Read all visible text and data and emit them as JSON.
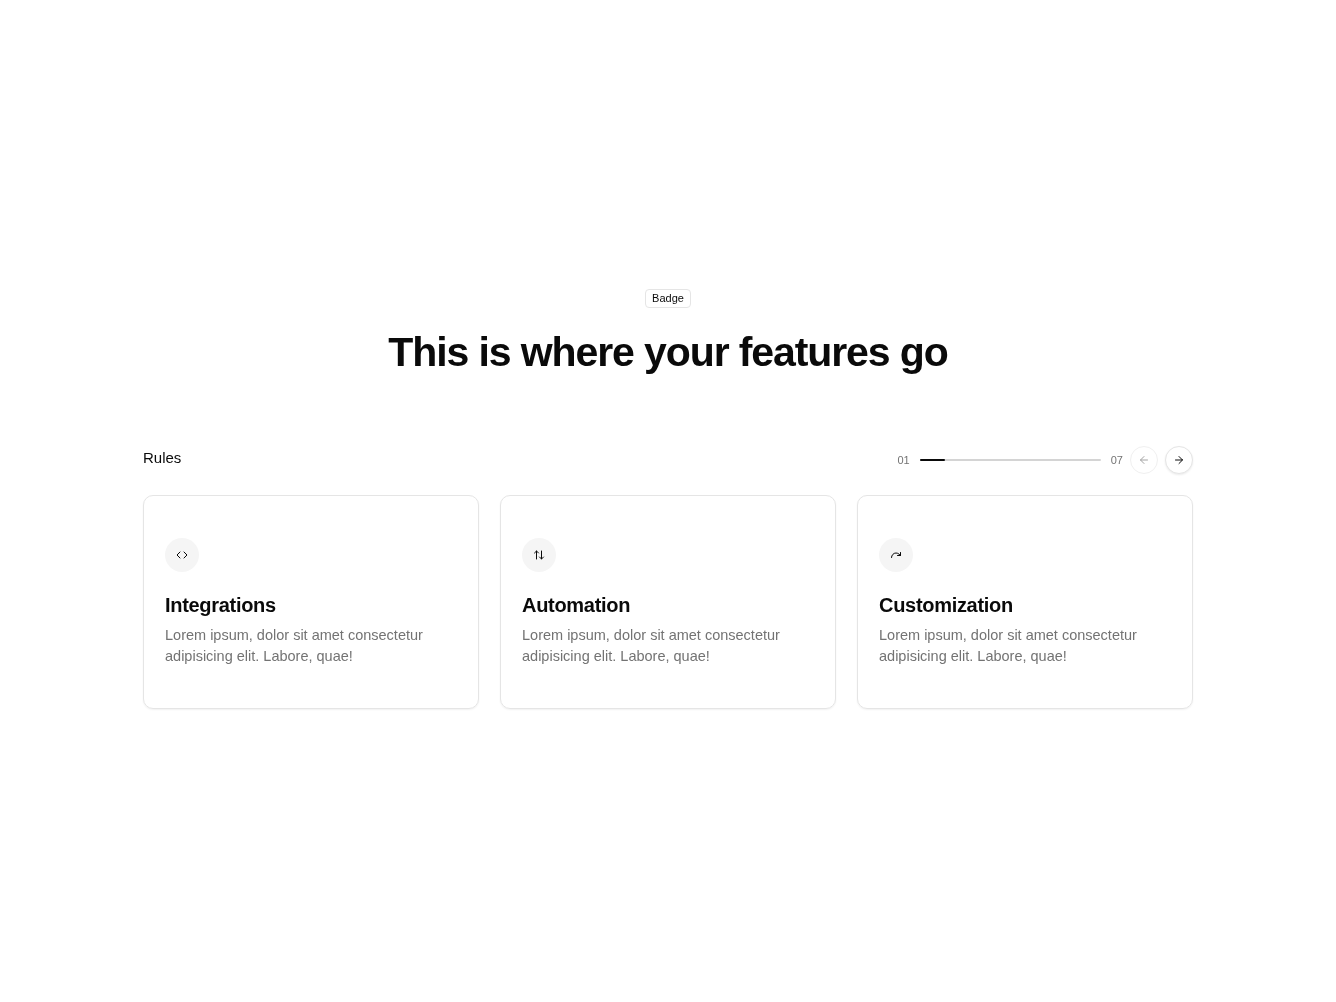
{
  "badge": "Badge",
  "heading": "This is where your features go",
  "section": {
    "title": "Rules",
    "pager": {
      "start": "01",
      "end": "07",
      "level": 0.14,
      "prev": {
        "disabled": true
      },
      "next": {
        "disabled": false
      }
    }
  },
  "features": [
    {
      "kind": "code",
      "title": "Integrations",
      "description": "Lorem ipsum, dolor sit amet consectetur adipisicing elit. Labore, quae!"
    },
    {
      "kind": "swap",
      "title": "Automation",
      "description": "Lorem ipsum, dolor sit amet consectetur adipisicing elit. Labore, quae!"
    },
    {
      "kind": "redo",
      "title": "Customization",
      "description": "Lorem ipsum, dolor sit amet consectetur adipisicing elit. Labore, quae!"
    }
  ]
}
